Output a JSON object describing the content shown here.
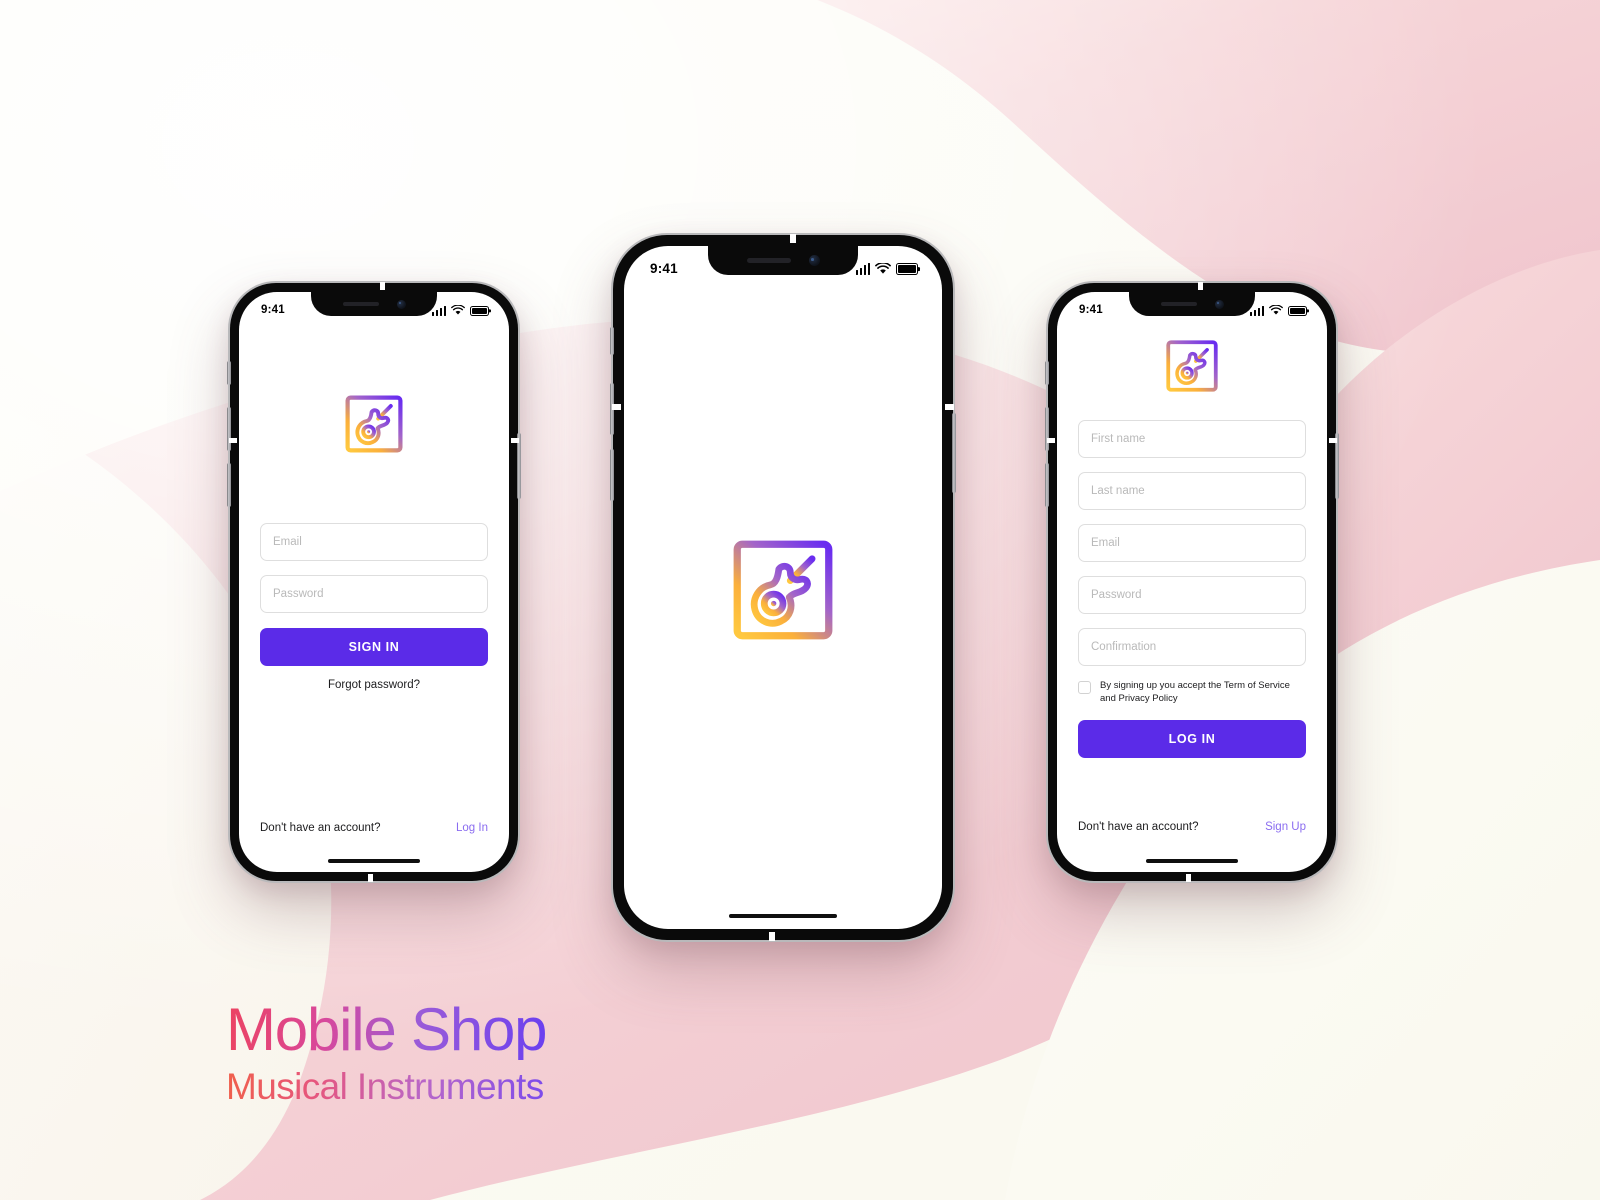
{
  "canvas": {
    "background_cream": "#fbfbf3",
    "background_pink": "#f3cfd4",
    "accent_purple": "#5b2be8",
    "link_purple": "#8a6cf0"
  },
  "branding": {
    "title": "Mobile Shop",
    "subtitle": "Musical Instruments"
  },
  "status_bar": {
    "time": "9:41",
    "signal_icon": "cellular-signal-icon",
    "wifi_icon": "wifi-icon",
    "battery_icon": "battery-icon"
  },
  "logo": {
    "name": "guitar-logo-icon",
    "gradient_from": "#ffc23c",
    "gradient_to": "#6a2df0"
  },
  "screens": [
    {
      "id": "sign-in",
      "name": "Sign In",
      "fields": [
        {
          "name": "email-field",
          "placeholder": "Email"
        },
        {
          "name": "password-field",
          "placeholder": "Password"
        }
      ],
      "primary_button": "SIGN IN",
      "forgot_link": "Forgot password?",
      "footer_text": "Don't have an account?",
      "footer_link": "Log In"
    },
    {
      "id": "splash",
      "name": "Splash"
    },
    {
      "id": "sign-up",
      "name": "Sign Up",
      "fields": [
        {
          "name": "first-name-field",
          "placeholder": "First name"
        },
        {
          "name": "last-name-field",
          "placeholder": "Last name"
        },
        {
          "name": "email-field",
          "placeholder": "Email"
        },
        {
          "name": "password-field",
          "placeholder": "Password"
        },
        {
          "name": "confirmation-field",
          "placeholder": "Confirmation"
        }
      ],
      "terms_text": "By signing up you accept the Term of Service and Privacy Policy",
      "primary_button": "LOG IN",
      "footer_text": "Don't have an account?",
      "footer_link": "Sign Up"
    }
  ]
}
